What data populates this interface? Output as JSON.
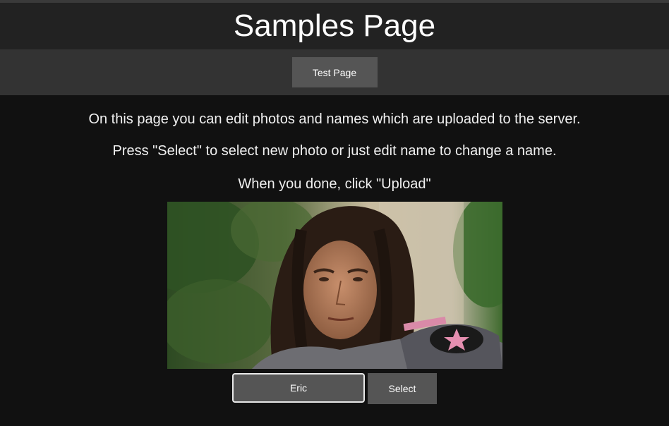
{
  "header": {
    "title": "Samples Page"
  },
  "nav": {
    "test_page_label": "Test Page"
  },
  "main": {
    "instructions": [
      "On this page you can edit photos and names which are uploaded to the server.",
      "Press \"Select\" to select new photo or just edit name to change a name.",
      "When you done, click \"Upload\""
    ],
    "sample": {
      "name_value": "Eric",
      "select_label": "Select"
    }
  },
  "colors": {
    "page_background": "#111111",
    "header_background": "#222222",
    "nav_background": "#333333",
    "button_background": "#555555",
    "text": "#ffffff"
  }
}
